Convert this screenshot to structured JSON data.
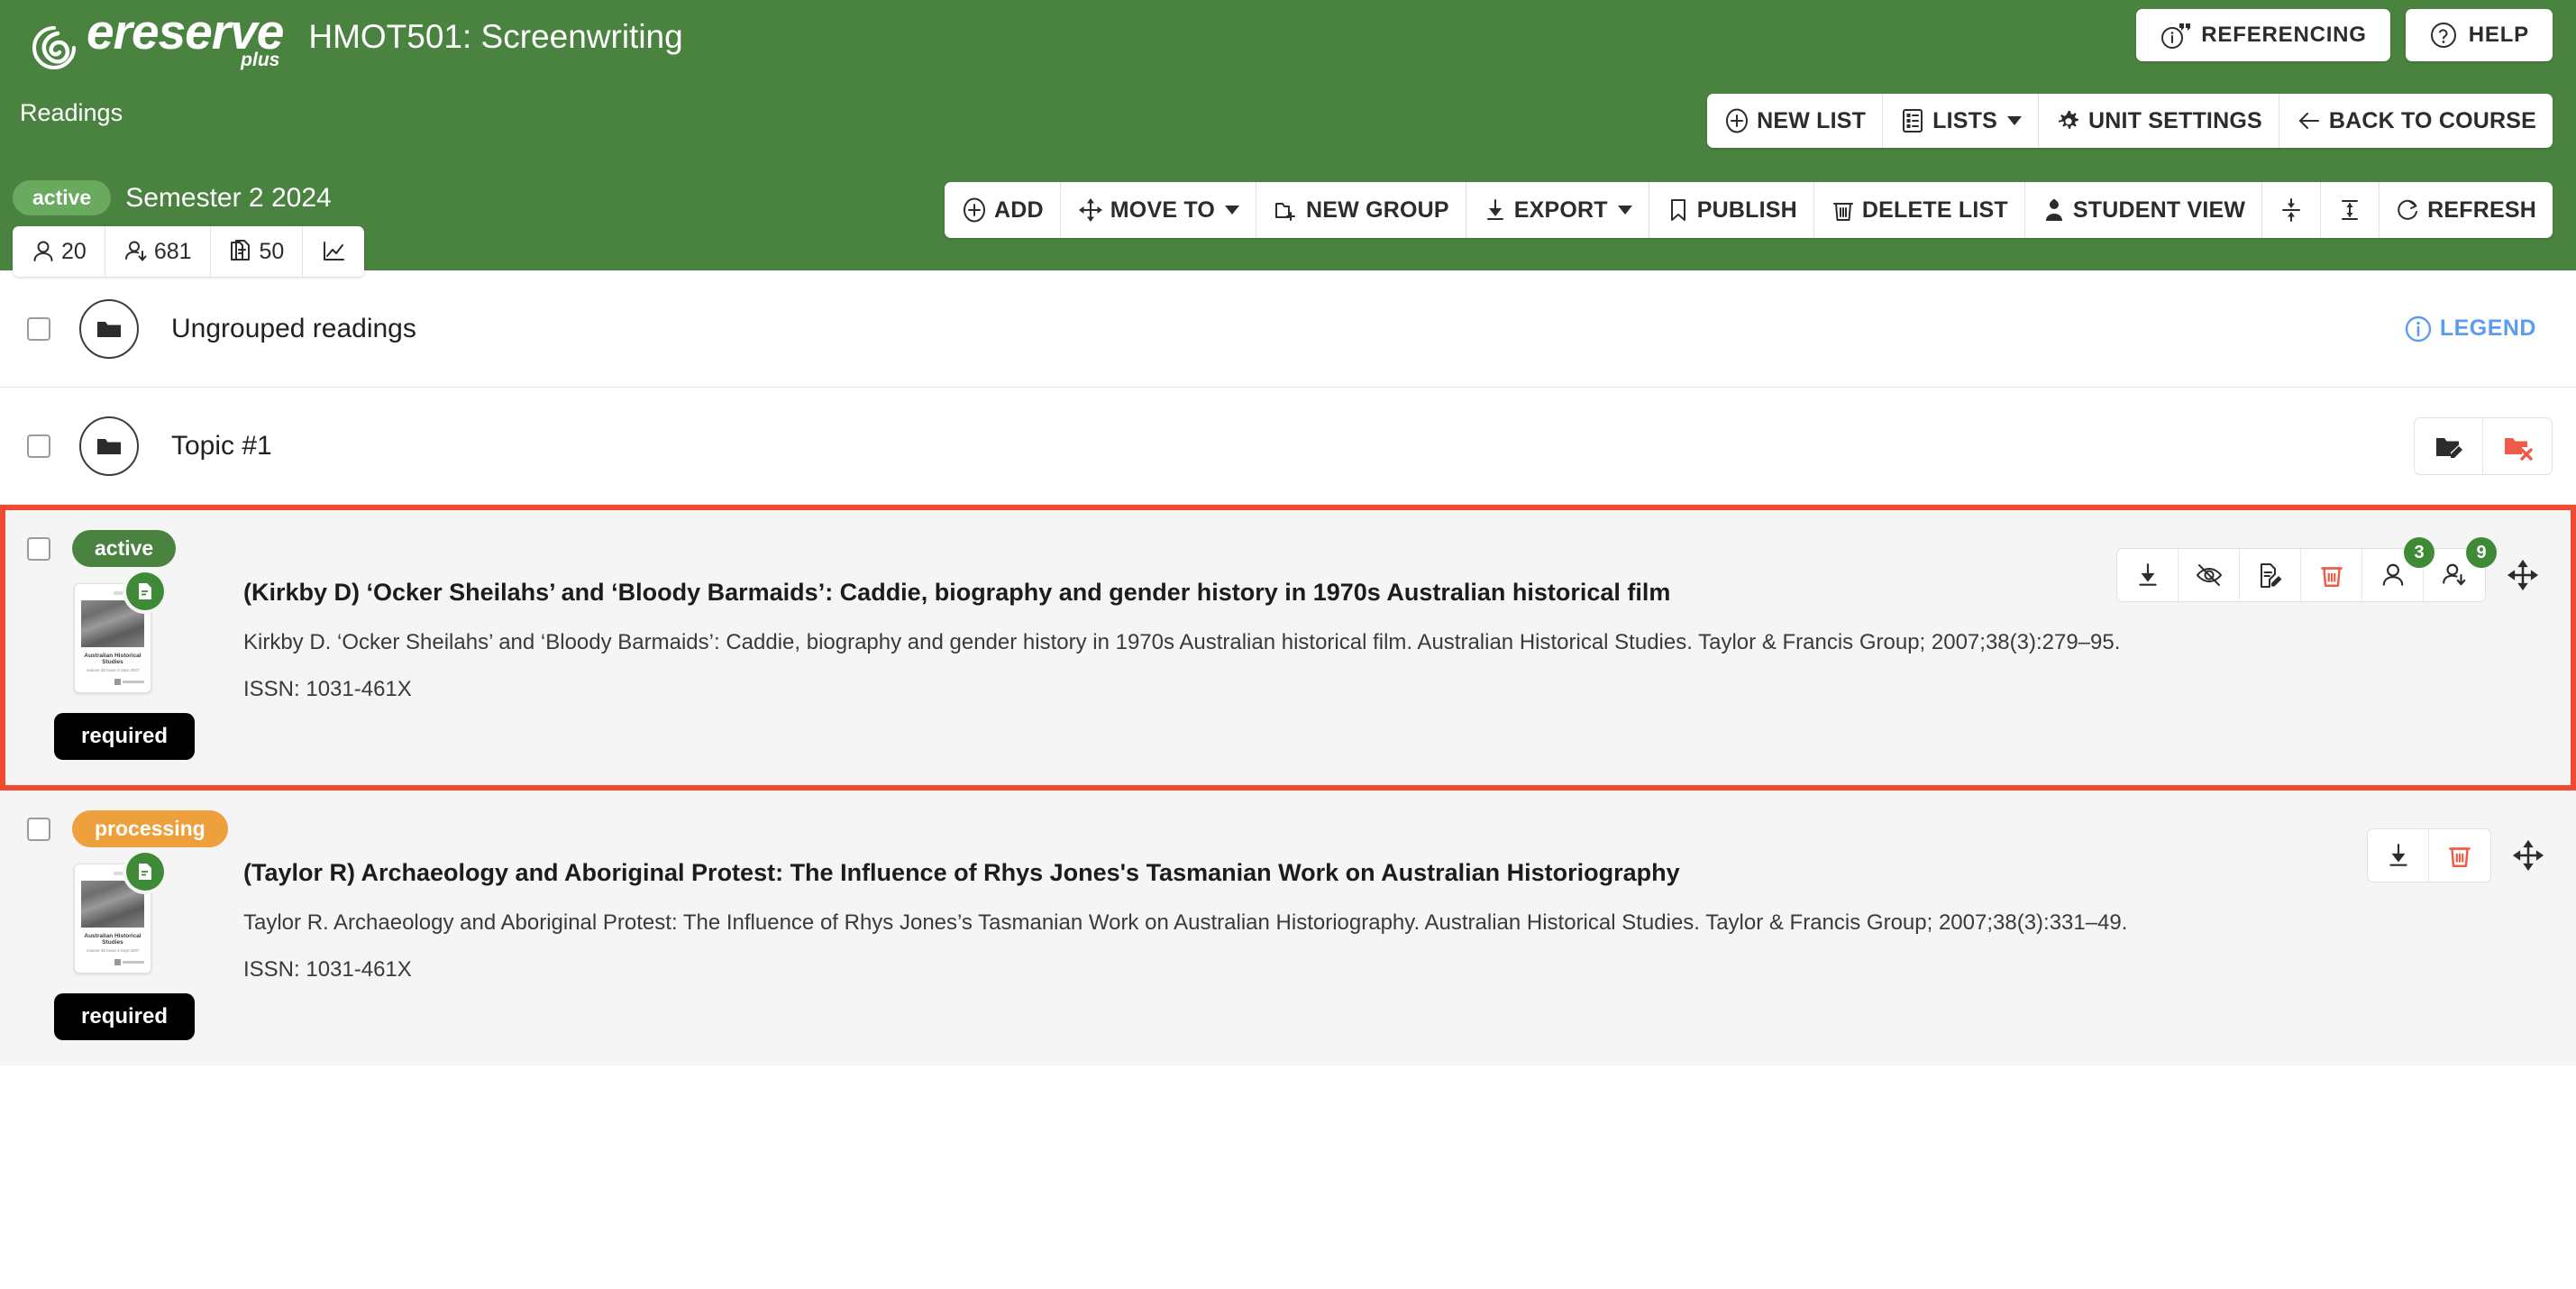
{
  "header": {
    "brand_name": "ereserve",
    "brand_suffix": "plus",
    "course_title": "HMOT501: Screenwriting",
    "breadcrumb": "Readings",
    "brand_green": "#4a8340",
    "buttons": [
      {
        "label": "REFERENCING",
        "icon": "info-quote-icon"
      },
      {
        "label": "HELP",
        "icon": "question-circle-icon"
      }
    ],
    "list_toolbar": [
      {
        "label": "NEW LIST",
        "icon": "plus-circle-icon",
        "caret": false
      },
      {
        "label": "LISTS",
        "icon": "list-icon",
        "caret": true
      },
      {
        "label": "UNIT SETTINGS",
        "icon": "gear-icon",
        "caret": false
      },
      {
        "label": "BACK TO COURSE",
        "icon": "arrow-left-icon",
        "caret": false
      }
    ],
    "action_toolbar": [
      {
        "label": "ADD",
        "icon": "plus-circle-icon",
        "caret": false
      },
      {
        "label": "MOVE TO",
        "icon": "move-arrows-icon",
        "caret": true
      },
      {
        "label": "NEW GROUP",
        "icon": "folder-plus-icon",
        "caret": false
      },
      {
        "label": "EXPORT",
        "icon": "download-icon",
        "caret": true
      },
      {
        "label": "PUBLISH",
        "icon": "bookmark-icon",
        "caret": false
      },
      {
        "label": "DELETE LIST",
        "icon": "trash-icon",
        "caret": false
      },
      {
        "label": "STUDENT VIEW",
        "icon": "student-icon",
        "caret": false
      },
      {
        "label": "",
        "icon": "collapse-all-icon",
        "caret": false
      },
      {
        "label": "",
        "icon": "expand-all-icon",
        "caret": false
      },
      {
        "label": "REFRESH",
        "icon": "refresh-icon",
        "caret": false
      }
    ],
    "semester": {
      "status": "active",
      "name": "Semester 2 2024",
      "status_color": "#6aaa5f",
      "stats": [
        {
          "icon": "person-icon",
          "value": "20"
        },
        {
          "icon": "person-download-icon",
          "value": "681"
        },
        {
          "icon": "documents-icon",
          "value": "50"
        },
        {
          "icon": "chart-line-icon",
          "value": ""
        }
      ]
    }
  },
  "groups": [
    {
      "name": "Ungrouped readings",
      "icon": "folder-icon",
      "legend_label": "LEGEND",
      "legend_icon": "info-circle-icon",
      "legend_color": "#5b9bf0",
      "actions": []
    },
    {
      "name": "Topic #1",
      "icon": "folder-icon",
      "actions": [
        {
          "icon": "folder-edit-icon",
          "color": "#2c2c2c"
        },
        {
          "icon": "folder-delete-icon",
          "color": "#ef5b48"
        }
      ]
    }
  ],
  "readings": [
    {
      "selected": true,
      "status": "active",
      "status_color": "#4a8340",
      "requirement": "required",
      "title": "(Kirkby D) ‘Ocker Sheilahs’ and ‘Bloody Barmaids’: Caddie, biography and gender history in 1970s Australian historical film",
      "citation": "Kirkby D. ‘Ocker Sheilahs’ and ‘Bloody Barmaids’: Caddie, biography and gender history in 1970s Australian historical film. Australian Historical Studies. Taylor & Francis Group; 2007;38(3):279–95.",
      "issn": "ISSN: 1031-461X",
      "thumbnail": {
        "journal_title": "Australian Historical Studies",
        "subtitle": "Volume 38 Issue 3 Sept 2007"
      },
      "actions": [
        {
          "icon": "download-icon",
          "color": "#2c2c2c",
          "badge": ""
        },
        {
          "icon": "eye-off-icon",
          "color": "#2c2c2c",
          "badge": ""
        },
        {
          "icon": "document-edit-icon",
          "color": "#2c2c2c",
          "badge": ""
        },
        {
          "icon": "trash-icon",
          "color": "#ef5b48",
          "badge": ""
        },
        {
          "icon": "person-icon",
          "color": "#2c2c2c",
          "badge": "3"
        },
        {
          "icon": "person-download-icon",
          "color": "#2c2c2c",
          "badge": "9"
        }
      ],
      "drag_icon": "move-arrows-icon"
    },
    {
      "selected": false,
      "status": "processing",
      "status_color": "#eda03c",
      "requirement": "required",
      "title": "(Taylor R) Archaeology and Aboriginal Protest: The Influence of Rhys Jones's Tasmanian Work on Australian Historiography",
      "citation": "Taylor R. Archaeology and Aboriginal Protest: The Influence of Rhys Jones’s Tasmanian Work on Australian Historiography. Australian Historical Studies. Taylor & Francis Group; 2007;38(3):331–49.",
      "issn": "ISSN: 1031-461X",
      "thumbnail": {
        "journal_title": "Australian Historical Studies",
        "subtitle": "Volume 38 Issue 3 Sept 2007"
      },
      "actions": [
        {
          "icon": "download-icon",
          "color": "#2c2c2c",
          "badge": ""
        },
        {
          "icon": "trash-icon",
          "color": "#ef5b48",
          "badge": ""
        }
      ],
      "drag_icon": "move-arrows-icon"
    }
  ]
}
